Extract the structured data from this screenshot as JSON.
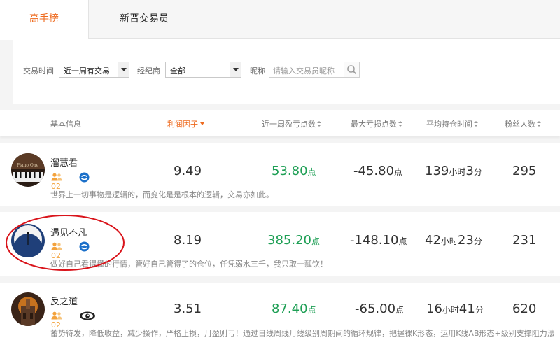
{
  "tabs": {
    "active": "高手榜",
    "second": "新晋交易员"
  },
  "filters": {
    "time_label": "交易时间",
    "time_value": "近一周有交易",
    "broker_label": "经纪商",
    "broker_value": "全部",
    "nick_label": "昵称",
    "nick_placeholder": "请输入交易员昵称"
  },
  "columns": {
    "info": "基本信息",
    "profit": "利润因子",
    "week": "近一周盈亏点数",
    "maxloss": "最大亏损点数",
    "hold": "平均持仓时间",
    "fans": "粉丝人数"
  },
  "units": {
    "points": "点",
    "hours": "小时",
    "minutes": "分"
  },
  "colors": {
    "accent": "#ee6a1e",
    "positive": "#1e9f55",
    "annotation_circle": "#d9141b"
  },
  "traders": [
    {
      "name": "溜慧君",
      "count": "02",
      "motto": "世界上一切事物是逻辑的，而变化是是根本的逻辑，交易亦如此。",
      "profit_factor": "9.49",
      "week_points": "53.80",
      "max_loss": "-45.80",
      "hold_hours": "139",
      "hold_minutes": "3",
      "fans": "295",
      "avatar_icon": "piano-icon",
      "level_icon": "blue-level-icon"
    },
    {
      "name": "遇见不凡",
      "count": "02",
      "motto": "做好自己看得懂的行情，管好自己管得了的仓位，任凭弱水三千，我只取一瓢饮！",
      "profit_factor": "8.19",
      "week_points": "385.20",
      "max_loss": "-148.10",
      "hold_hours": "42",
      "hold_minutes": "23",
      "fans": "231",
      "avatar_icon": "moon-icon",
      "level_icon": "blue-level-icon"
    },
    {
      "name": "反之道",
      "count": "02",
      "motto": "蓄势待发，降低收益，减少操作，严格止损，月盈则亏！通过日线周线月线级别周期间的循环规律，把握裸K形态，运用K线AB形态+级别支撑阻力法",
      "profit_factor": "3.51",
      "week_points": "87.40",
      "max_loss": "-65.00",
      "hold_hours": "16",
      "hold_minutes": "41",
      "fans": "620",
      "avatar_icon": "castle-icon",
      "level_icon": "eye-level-icon"
    }
  ]
}
